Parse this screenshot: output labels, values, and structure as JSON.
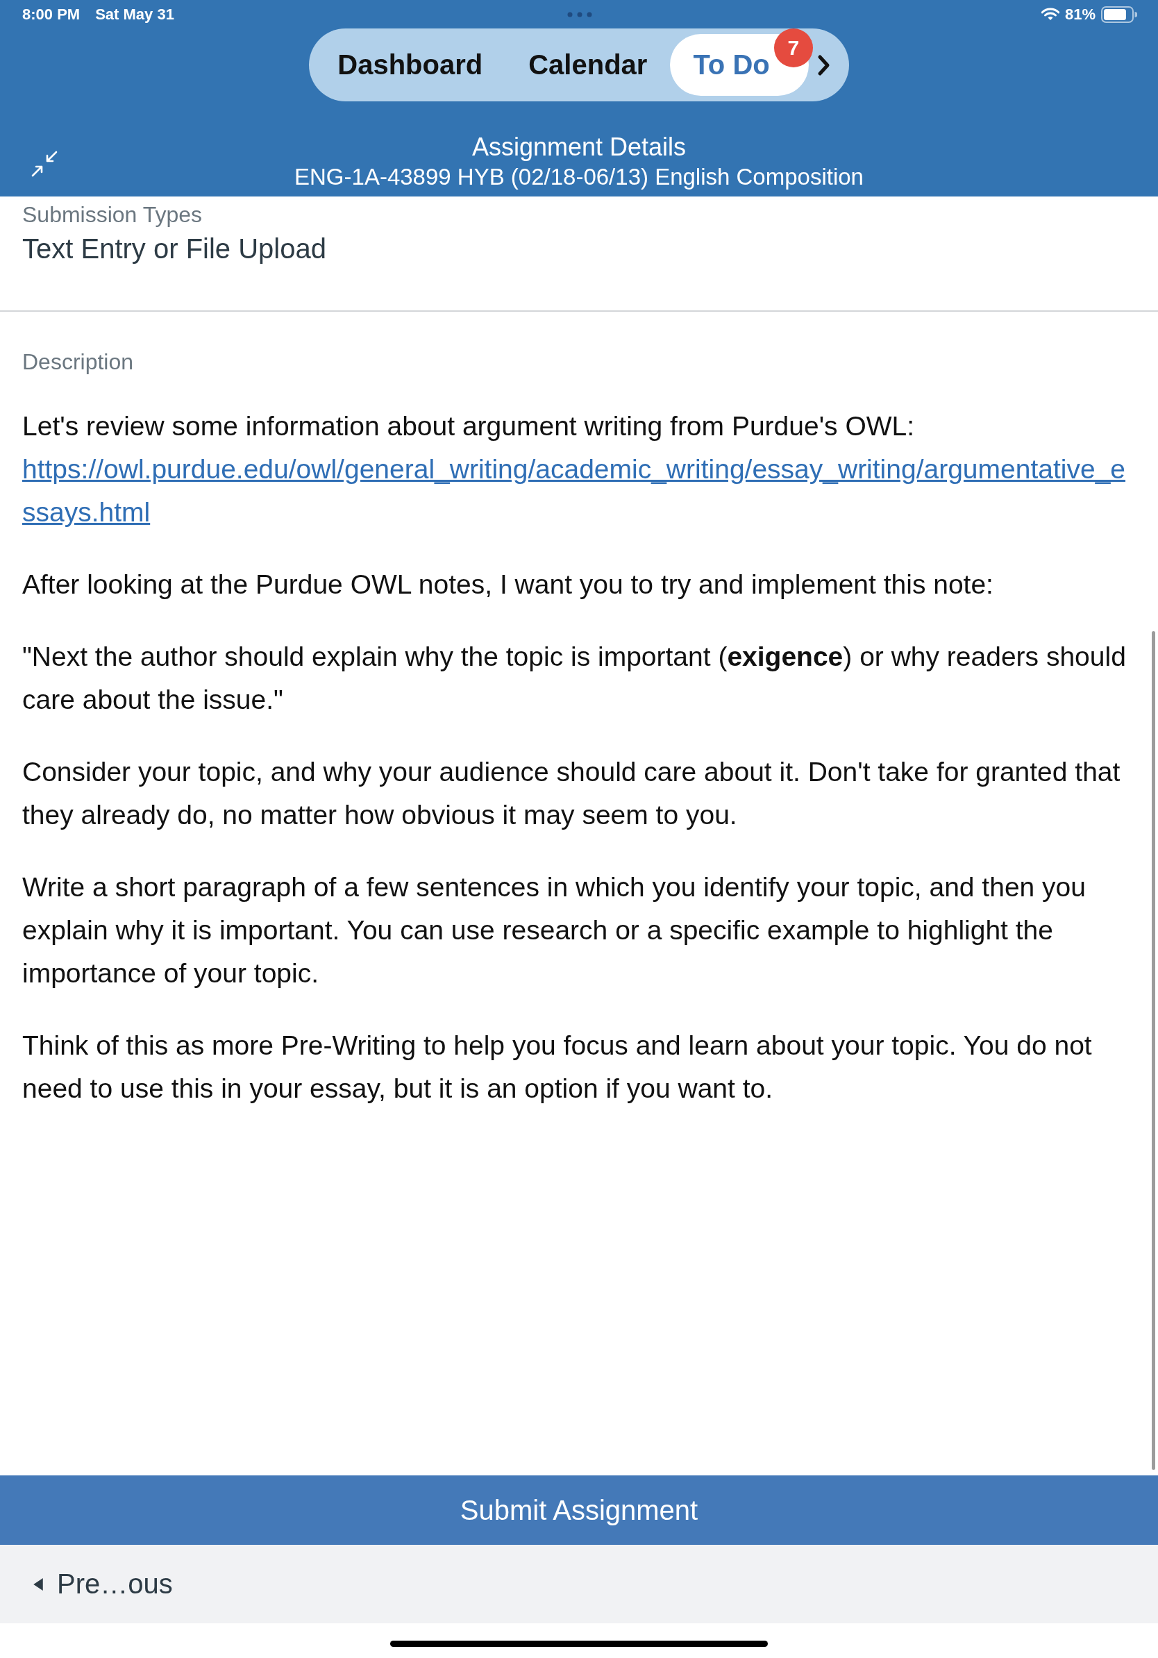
{
  "status_bar": {
    "time": "8:00 PM",
    "date": "Sat May 31",
    "battery": "81%"
  },
  "tabs": [
    {
      "label": "Dashboard",
      "selected": false
    },
    {
      "label": "Calendar",
      "selected": false
    },
    {
      "label": "To Do",
      "selected": true,
      "badge": "7"
    }
  ],
  "header": {
    "title": "Assignment Details",
    "subtitle": "ENG-1A-43899 HYB (02/18-06/13) English Composition"
  },
  "submission_types": {
    "label": "Submission Types",
    "value": "Text Entry or File Upload"
  },
  "description": {
    "label": "Description",
    "paragraphs": [
      {
        "text": "Let's review some information about argument writing from Purdue's OWL:",
        "link": "https://owl.purdue.edu/owl/general_writing/academic_writing/essay_writing/argumentative_essays.html"
      },
      {
        "text": "After looking at the Purdue OWL notes, I want you to try and implement this note:"
      },
      {
        "text": "\"Next the author should explain why the topic is important (**exigence**) or why readers should care about the issue.\""
      },
      {
        "text": "Consider your topic, and why your audience should care about it. Don't take for granted that they already do, no matter how obvious it may seem to you."
      },
      {
        "text": "Write a short paragraph of a few sentences in which you identify your topic, and then you explain why it is important. You can use research or a specific example to highlight the importance of your topic."
      },
      {
        "text": "Think of this as more Pre-Writing to help you focus and learn about your topic. You do not need to use this in your essay, but it is an option if you want to."
      }
    ]
  },
  "footer": {
    "submit": "Submit Assignment",
    "previous": "Pre…ous"
  }
}
